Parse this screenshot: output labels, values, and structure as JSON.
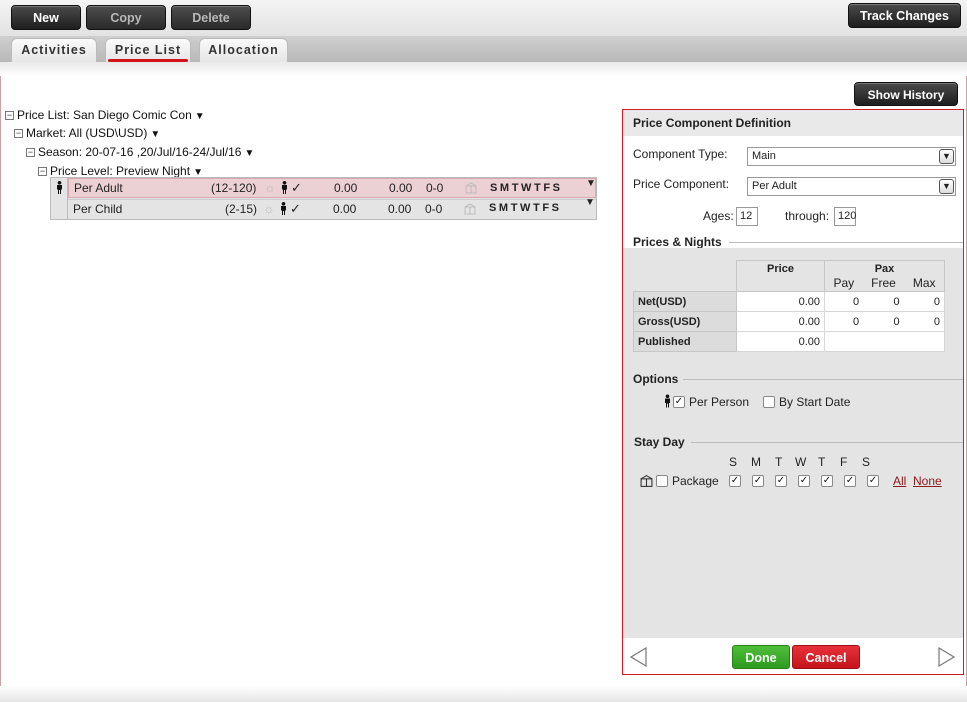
{
  "toolbar": {
    "new_label": "New",
    "copy_label": "Copy",
    "delete_label": "Delete",
    "track_changes_label": "Track Changes"
  },
  "tabs": [
    {
      "label": "Activities",
      "active": false
    },
    {
      "label": "Price List",
      "active": true
    },
    {
      "label": "Allocation",
      "active": false
    }
  ],
  "show_history_label": "Show History",
  "tree": {
    "price_list": "Price List: San Diego Comic Con",
    "market": "Market: All (USD\\USD)",
    "season": "Season: 20-07-16 ,20/Jul/16-24/Jul/16",
    "price_level": "Price Level: Preview Night",
    "rows": [
      {
        "name": "Per Adult",
        "ages": "(12-120)",
        "net": "0.00",
        "gross": "0.00",
        "pax": "0-0",
        "days": "SMTWTFS",
        "selected": true
      },
      {
        "name": "Per Child",
        "ages": "(2-15)",
        "net": "0.00",
        "gross": "0.00",
        "pax": "0-0",
        "days": "SMTWTFS",
        "selected": false
      }
    ]
  },
  "panel": {
    "title": "Price Component Definition",
    "component_type_label": "Component Type:",
    "component_type_value": "Main",
    "price_component_label": "Price Component:",
    "price_component_value": "Per Adult",
    "ages_label": "Ages:",
    "ages_from": "12",
    "through_label": "through:",
    "ages_to": "120",
    "prices_nights_title": "Prices & Nights",
    "price_header": "Price",
    "pax_header": "Pax",
    "pay_header": "Pay",
    "free_header": "Free",
    "max_header": "Max",
    "rows": [
      {
        "label": "Net(USD)",
        "price": "0.00",
        "pay": "0",
        "free": "0",
        "max": "0"
      },
      {
        "label": "Gross(USD)",
        "price": "0.00",
        "pay": "0",
        "free": "0",
        "max": "0"
      },
      {
        "label": "Published",
        "price": "0.00",
        "pay": "",
        "free": "",
        "max": ""
      }
    ],
    "options_title": "Options",
    "per_person_label": "Per Person",
    "per_person_checked": true,
    "by_start_date_label": "By Start Date",
    "by_start_date_checked": false,
    "stay_day_title": "Stay Day",
    "day_letters": [
      "S",
      "M",
      "T",
      "W",
      "T",
      "F",
      "S"
    ],
    "package_label": "Package",
    "package_checked": false,
    "all_label": "All",
    "none_label": "None",
    "done_label": "Done",
    "cancel_label": "Cancel"
  },
  "colors": {
    "accent_red": "#d01c25",
    "done_green": "#3aa92a",
    "selected_row": "#ecd1d4"
  }
}
